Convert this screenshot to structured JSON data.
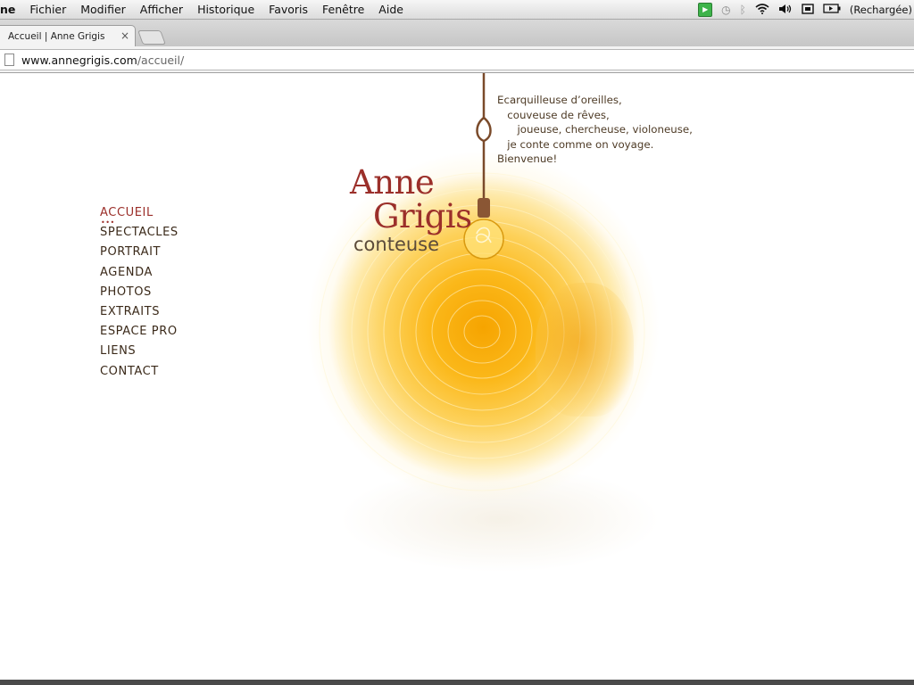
{
  "menubar": {
    "app": "ne",
    "items": [
      "Fichier",
      "Modifier",
      "Afficher",
      "Historique",
      "Favoris",
      "Fenêtre",
      "Aide"
    ],
    "tray": {
      "icons": [
        "media-play-icon",
        "time-machine-icon",
        "bluetooth-icon",
        "wifi-icon",
        "volume-icon",
        "keyboard-icon",
        "battery-icon"
      ],
      "battery_status": "(Rechargée)"
    }
  },
  "browser": {
    "tab_title": "Accueil | Anne Grigis",
    "tab_close": "×",
    "url_host": "www.annegrigis.com",
    "url_path": "/accueil/"
  },
  "page": {
    "title_line1": "Anne",
    "title_line2": "Grigis",
    "subtitle": "conteuse",
    "tagline": "Ecarquilleuse d’oreilles,\n   couveuse de rêves,\n      joueuse, chercheuse, violoneuse,\n   je conte comme on voyage.\nBienvenue!",
    "nav": {
      "active_marker": "•••",
      "items": [
        "ACCUEIL",
        "SPECTACLES",
        "PORTRAIT",
        "AGENDA",
        "PHOTOS",
        "EXTRAITS",
        "ESPACE PRO",
        "LIENS",
        "CONTACT"
      ]
    },
    "colors": {
      "accent": "#9b2f2a",
      "text": "#3b2a1a",
      "wood": "#f6a400"
    }
  }
}
